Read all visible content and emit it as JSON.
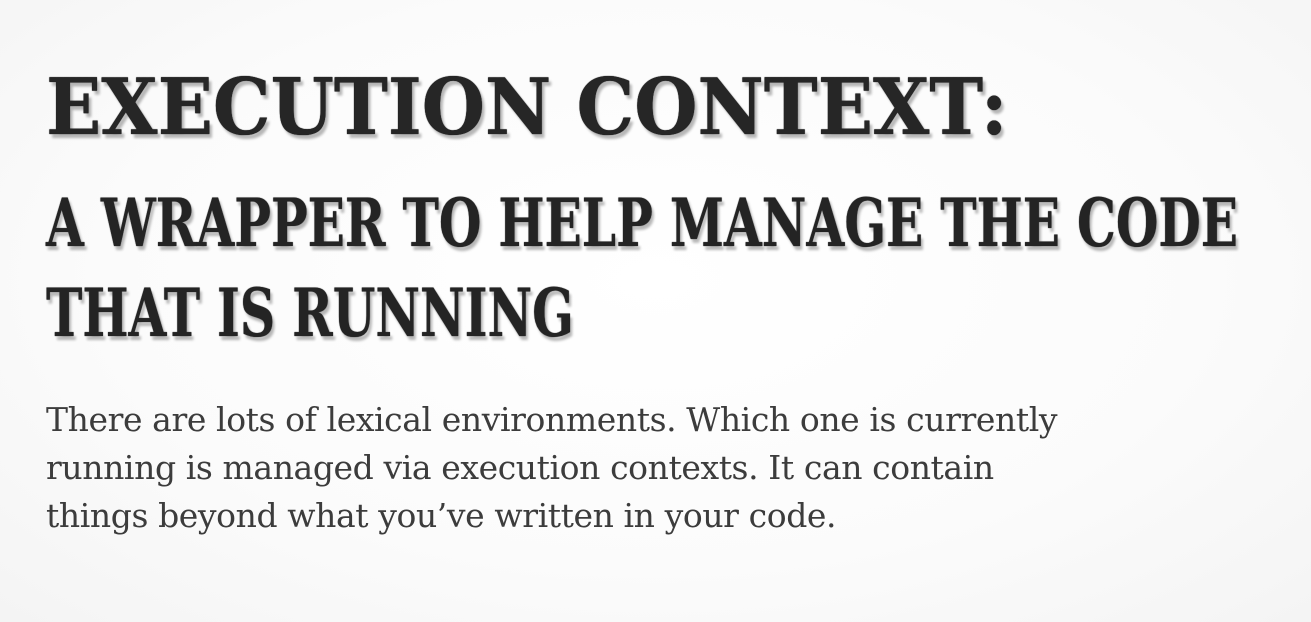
{
  "slide": {
    "title": "EXECUTION CONTEXT:",
    "subtitle_lines": [
      "A WRAPPER TO HELP MANAGE THE CODE",
      "THAT IS RUNNING"
    ],
    "body_lines": [
      "There are lots of lexical environments. Which one is currently",
      "running is managed via execution contexts. It can contain",
      "things beyond what you’ve written in your code."
    ]
  },
  "colors": {
    "background": "#fdfdfd",
    "title_text": "#262626",
    "body_text": "#3c3c3c"
  }
}
